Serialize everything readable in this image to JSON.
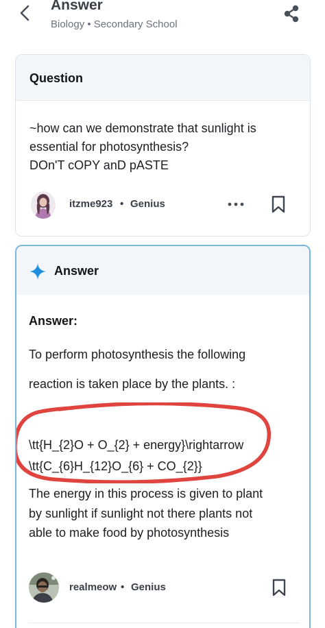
{
  "header": {
    "title": "Answer",
    "subject": "Biology • Secondary School"
  },
  "question": {
    "heading": "Question",
    "lines": [
      "~how can we demonstrate that sunlight is",
      "essential for photosynthesis?",
      "DOn'T cOPY anD pASTE"
    ],
    "author": "itzme923",
    "separator": "•",
    "rank": "Genius"
  },
  "answer": {
    "heading": "Answer",
    "label": "Answer:",
    "lines": [
      "To perform photosynthesis the following",
      "reaction is taken place by the plants. :",
      "\\tt{H_{2}O + O_{2} + energy}\\rightarrow",
      "\\tt{C_{6}H_{12}O_{6} + CO_{2}}",
      "The energy in this process is given to plant",
      "by sunlight if sunlight not there plants not",
      "able to make food by photosynthesis"
    ],
    "author": "realmeow",
    "separator": "•",
    "rank": "Genius"
  },
  "colors": {
    "accent_blue": "#1f8de0",
    "answer_border": "#77b8dc",
    "highlight_circle": "#e0443f"
  }
}
